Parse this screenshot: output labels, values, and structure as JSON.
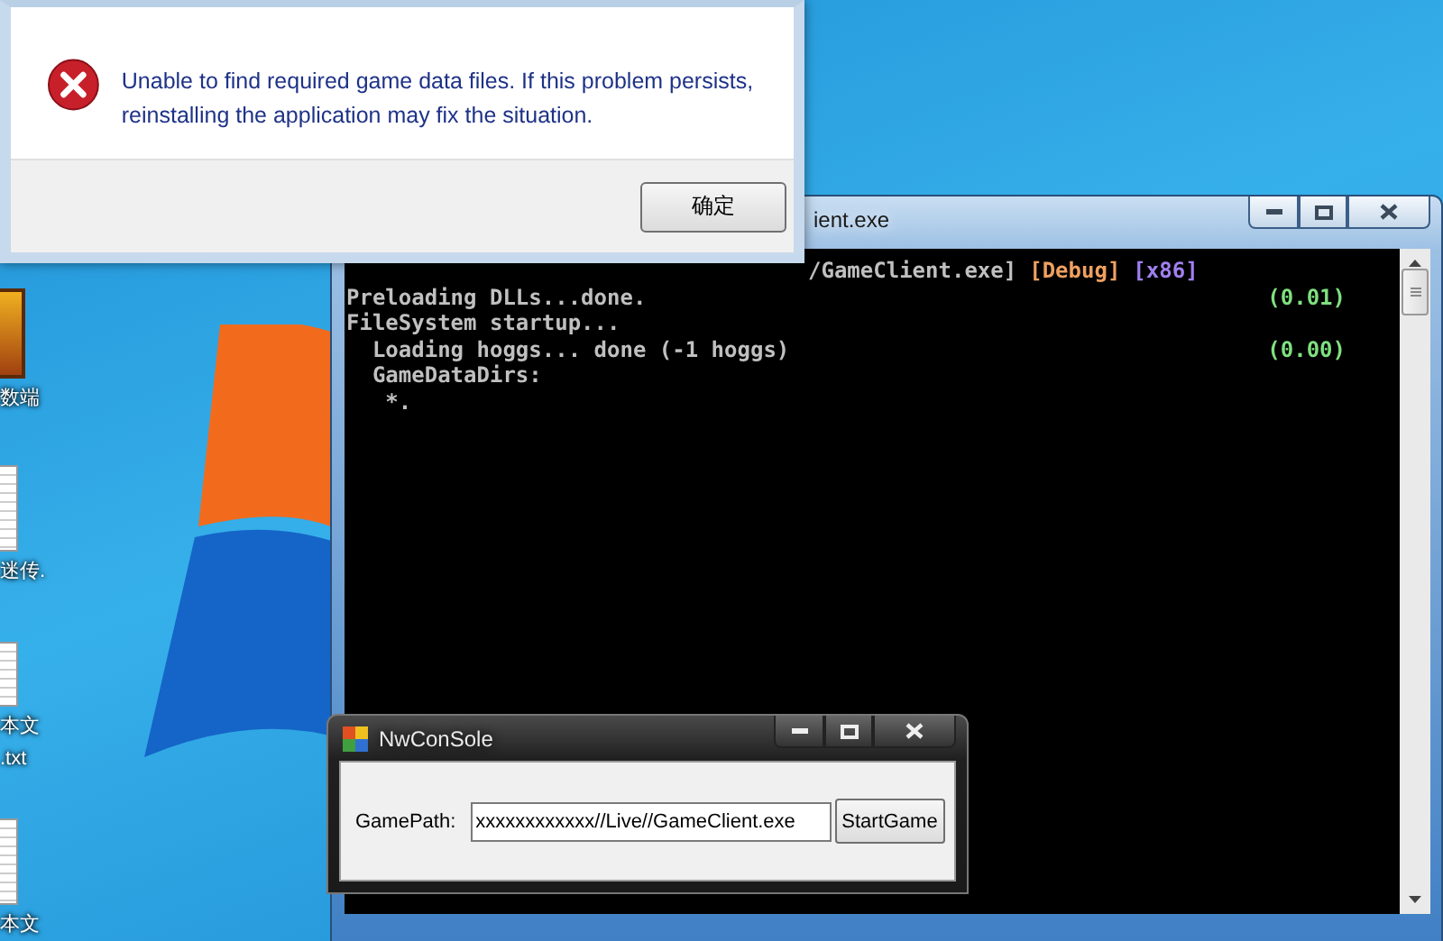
{
  "desktop": {
    "icons": [
      {
        "kind": "game",
        "label": "数端"
      },
      {
        "kind": "document",
        "label": "迷传."
      },
      {
        "kind": "document",
        "label": "本文",
        "sublabel": ".txt"
      },
      {
        "kind": "document",
        "label": "本文"
      }
    ]
  },
  "error_dialog": {
    "message": "Unable to find required game data files.  If this problem persists, reinstalling the application may fix the situation.",
    "button": "确定"
  },
  "console": {
    "title": "ient.exe",
    "header": [
      {
        "text": "/GameClient.exe]",
        "color": "#c0c0c0"
      },
      {
        "text": "[Debug]",
        "color": "#f0a060"
      },
      {
        "text": "[x86]",
        "color": "#a080f0"
      }
    ],
    "lines": [
      {
        "text": "Preloading DLLs...done.",
        "time": "(0.01)"
      },
      {
        "text": "FileSystem startup..."
      },
      {
        "text": "  Loading hoggs... done (-1 hoggs)",
        "time": "(0.00)"
      },
      {
        "text": "  GameDataDirs:"
      },
      {
        "text": "   *."
      }
    ]
  },
  "launcher": {
    "title": "NwConSole",
    "label": "GamePath:",
    "value": "xxxxxxxxxxxx//Live//GameClient.exe",
    "button": "StartGame"
  }
}
